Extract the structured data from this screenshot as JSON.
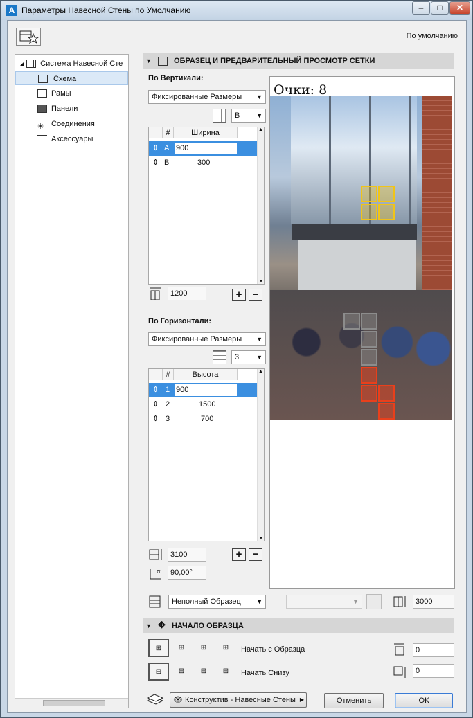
{
  "window": {
    "title": "Параметры Навесной Стены по Умолчанию",
    "minimize": "–",
    "maximize": "□",
    "close": "✕"
  },
  "header": {
    "default_label": "По умолчанию"
  },
  "tree": {
    "root": "Система Навесной Сте",
    "items": [
      "Схема",
      "Рамы",
      "Панели",
      "Соединения",
      "Аксессуары"
    ]
  },
  "preview_section": {
    "title": "ОБРАЗЕЦ И ПРЕДВАРИТЕЛЬНЫЙ ПРОСМОТР СЕТКИ",
    "score": "Очки: 8"
  },
  "vertical": {
    "label": "По Вертикали:",
    "mode": "Фиксированные Размеры",
    "letter": "B",
    "col_hash": "#",
    "col_name": "Ширина",
    "rows": [
      {
        "id": "A",
        "value": "900"
      },
      {
        "id": "B",
        "value": "300"
      }
    ],
    "total": "1200"
  },
  "horizontal": {
    "label": "По Горизонтали:",
    "mode": "Фиксированные Размеры",
    "count": "3",
    "col_hash": "#",
    "col_name": "Высота",
    "rows": [
      {
        "id": "1",
        "value": "900"
      },
      {
        "id": "2",
        "value": "1500"
      },
      {
        "id": "3",
        "value": "700"
      }
    ],
    "total": "3100",
    "angle": "90,00°"
  },
  "pattern": {
    "mode": "Неполный Образец",
    "height": "3000"
  },
  "origin_section": {
    "title": "НАЧАЛО ОБРАЗЦА",
    "start_from_pattern": "Начать с Образца",
    "start_from_bottom": "Начать Снизу",
    "offset1": "0",
    "offset2": "0"
  },
  "footer": {
    "layer": "Конструктив - Навесные Стены",
    "cancel": "Отменить",
    "ok": "ОК"
  },
  "colors": {
    "selected_row": "#3b8fe0",
    "yellow_cell": "#f0c419",
    "red_cell": "#e8401c",
    "gray_cell": "#8c8c8c"
  }
}
